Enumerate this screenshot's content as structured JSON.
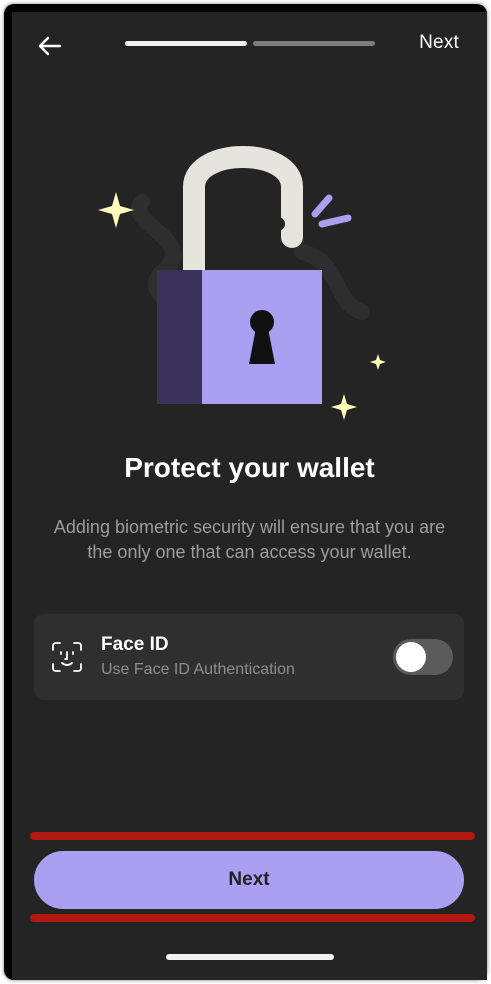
{
  "header": {
    "back_icon": "arrow-left-icon",
    "next_label": "Next",
    "progress_steps": 2,
    "progress_active_step": 1
  },
  "illustration": {
    "icon": "open-padlock-icon",
    "colors": {
      "lock_body": "#ab9ff2",
      "lock_shadow": "#3c315b",
      "sparkle": "#fffdbb"
    }
  },
  "main": {
    "title": "Protect your wallet",
    "description": "Adding biometric security will ensure that you are the only one that can access your wallet."
  },
  "face_id": {
    "icon": "face-id-icon",
    "title": "Face ID",
    "subtitle": "Use Face ID Authentication",
    "enabled": false
  },
  "footer": {
    "next_label": "Next"
  },
  "colors": {
    "background": "#242424",
    "card": "#2f2f2f",
    "accent": "#ab9ff2",
    "annotation_red": "#c8180c"
  }
}
